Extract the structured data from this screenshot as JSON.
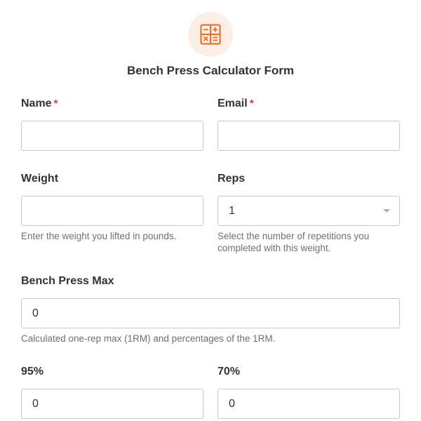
{
  "form": {
    "title": "Bench Press Calculator Form",
    "icon": "calculator-icon",
    "accent_color": "#e27730"
  },
  "fields": {
    "name": {
      "label": "Name",
      "required_mark": "*",
      "value": ""
    },
    "email": {
      "label": "Email",
      "required_mark": "*",
      "value": ""
    },
    "weight": {
      "label": "Weight",
      "value": "",
      "description": "Enter the weight you lifted in pounds."
    },
    "reps": {
      "label": "Reps",
      "selected": "1",
      "description": "Select the number of repetitions you completed with this weight."
    },
    "bench_max": {
      "label": "Bench Press Max",
      "value": "0",
      "description": "Calculated one-rep max (1RM) and percentages of the 1RM."
    },
    "pct95": {
      "label": "95%",
      "value": "0"
    },
    "pct70": {
      "label": "70%",
      "value": "0"
    }
  }
}
